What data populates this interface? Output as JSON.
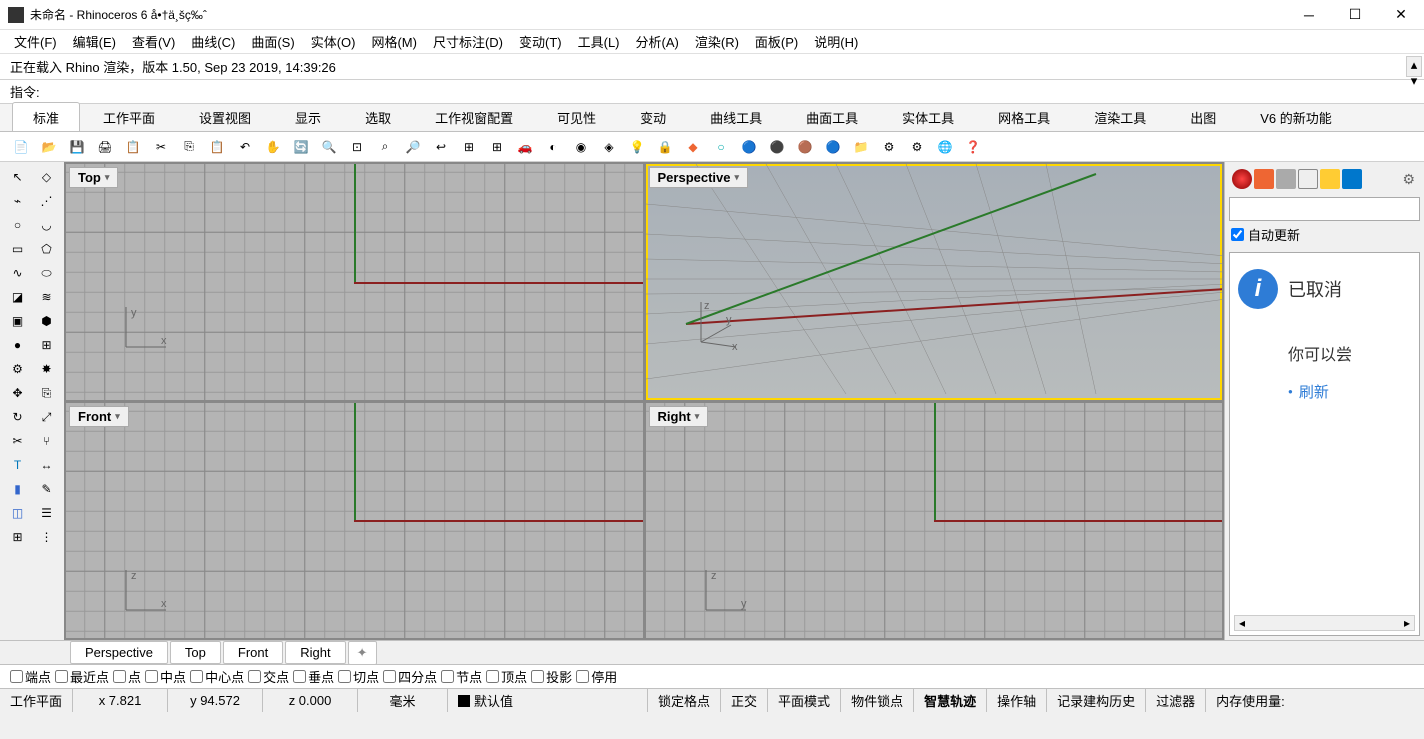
{
  "title": "未命名 - Rhinoceros 6 å•†ä¸šç‰ˆ",
  "menu": [
    "文件(F)",
    "编辑(E)",
    "查看(V)",
    "曲线(C)",
    "曲面(S)",
    "实体(O)",
    "网格(M)",
    "尺寸标注(D)",
    "变动(T)",
    "工具(L)",
    "分析(A)",
    "渲染(R)",
    "面板(P)",
    "说明(H)"
  ],
  "cmd_history": "正在载入 Rhino 渲染，版本 1.50, Sep 23 2019, 14:39:26",
  "cmd_prompt": "指令:",
  "tabs": [
    "标准",
    "工作平面",
    "设置视图",
    "显示",
    "选取",
    "工作视窗配置",
    "可见性",
    "变动",
    "曲线工具",
    "曲面工具",
    "实体工具",
    "网格工具",
    "渲染工具",
    "出图",
    "V6 的新功能"
  ],
  "viewport_labels": {
    "top": "Top",
    "persp": "Perspective",
    "front": "Front",
    "right": "Right"
  },
  "right_panel": {
    "auto_update": "自动更新",
    "info_title": "已取消",
    "sub_text": "你可以尝",
    "link": "刷新"
  },
  "vp_tabs": [
    "Perspective",
    "Top",
    "Front",
    "Right"
  ],
  "osnap": [
    "端点",
    "最近点",
    "点",
    "中点",
    "中心点",
    "交点",
    "垂点",
    "切点",
    "四分点",
    "节点",
    "顶点",
    "投影",
    "停用"
  ],
  "status": {
    "cplane": "工作平面",
    "x": "x 7.821",
    "y": "y 94.572",
    "z": "z 0.000",
    "units": "毫米",
    "layer": "默认值",
    "gridlock": "锁定格点",
    "ortho": "正交",
    "planar": "平面模式",
    "objsnap": "物件锁点",
    "smarttrack": "智慧轨迹",
    "gumball": "操作轴",
    "history": "记录建构历史",
    "filter": "过滤器",
    "mem": "内存使用量:"
  }
}
